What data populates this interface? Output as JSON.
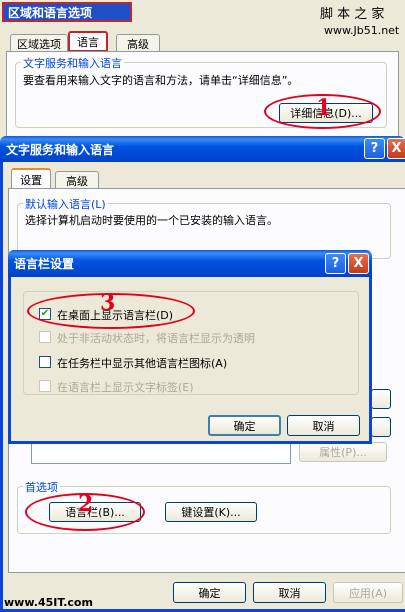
{
  "watermark_top": {
    "brand": "脚 本 之 家",
    "url": "www.Jb51.net"
  },
  "watermark_bottom": "www.45IT.com",
  "back_window": {
    "title": "区域和语言选项",
    "tabs": [
      "区域选项",
      "语言",
      "高级"
    ],
    "group_label": "文字服务和输入语言",
    "group_text": "要查看用来输入文字的语言和方法，请单击“详细信息”。",
    "details_button": "详细信息(D)..."
  },
  "mid_window": {
    "title": "文字服务和输入语言",
    "help": "?",
    "close": "X",
    "tabs": [
      "设置",
      "高级"
    ],
    "default_group_label": "默认输入语言(L)",
    "default_group_text": "选择计算机启动时要使用的一个已安装的输入语言。",
    "properties_button": "属性(P)...",
    "prefs_label": "首选项",
    "language_bar_button": "语言栏(B)...",
    "key_settings_button": "键设置(K)...",
    "ok": "确定",
    "cancel": "取消",
    "apply": "应用(A)"
  },
  "front_dialog": {
    "title": "语言栏设置",
    "help": "?",
    "close": "X",
    "options": [
      {
        "label": "在桌面上显示语言栏(D)",
        "checked": true,
        "enabled": true
      },
      {
        "label": "处于非活动状态时，将语言栏显示为透明",
        "checked": false,
        "enabled": false
      },
      {
        "label": "在任务栏中显示其他语言栏图标(A)",
        "checked": false,
        "enabled": true
      },
      {
        "label": "在语言栏上显示文字标签(E)",
        "checked": false,
        "enabled": false
      }
    ],
    "ok": "确定",
    "cancel": "取消"
  },
  "annotations": {
    "step1": "1",
    "step2": "2",
    "step3": "3",
    "color": "#e3001b"
  }
}
